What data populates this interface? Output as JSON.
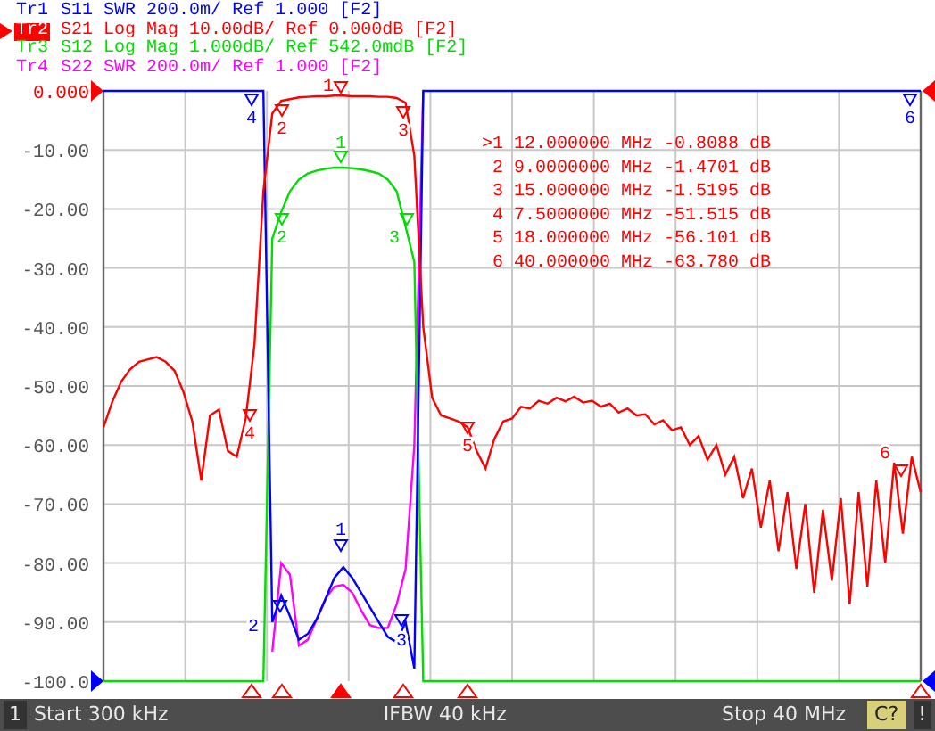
{
  "traces": [
    {
      "name": "Tr1",
      "parameter": "S11",
      "format": "SWR",
      "scale": "200.0m/",
      "reference": "Ref 1.000",
      "flag": "[F2]",
      "color": "#0000ff",
      "selected": false,
      "markers": [
        "4",
        "1",
        "2",
        "3",
        "6"
      ]
    },
    {
      "name": "Tr2",
      "parameter": "S21",
      "format": "Log Mag",
      "scale": "10.00dB/",
      "reference": "Ref 0.000dB",
      "flag": "[F2]",
      "color": "#ff0000",
      "selected": true,
      "markers": [
        "1",
        "2",
        "3",
        "4",
        "5",
        "6"
      ]
    },
    {
      "name": "Tr3",
      "parameter": "S12",
      "format": "Log Mag",
      "scale": "1.000dB/",
      "reference": "Ref 542.0mdB",
      "flag": "[F2]",
      "color": "#00dd00",
      "selected": false,
      "markers": [
        "1",
        "2",
        "3"
      ]
    },
    {
      "name": "Tr4",
      "parameter": "S22",
      "format": "SWR",
      "scale": "200.0m/",
      "reference": "Ref 1.000",
      "flag": "[F2]",
      "color": "#ff00ff",
      "selected": false
    }
  ],
  "chart_data": {
    "type": "line",
    "grid": true,
    "ylim": [
      -100,
      0
    ],
    "yticks": [
      {
        "value": 0,
        "label": "0.000"
      },
      {
        "value": -10,
        "label": "-10.00"
      },
      {
        "value": -20,
        "label": "-20.00"
      },
      {
        "value": -30,
        "label": "-30.00"
      },
      {
        "value": -40,
        "label": "-40.00"
      },
      {
        "value": -50,
        "label": "-50.00"
      },
      {
        "value": -60,
        "label": "-60.00"
      },
      {
        "value": -70,
        "label": "-70.00"
      },
      {
        "value": -80,
        "label": "-80.00"
      },
      {
        "value": -90,
        "label": "-90.00"
      },
      {
        "value": -100,
        "label": "-100.0"
      }
    ],
    "categories": [
      null,
      null,
      null,
      null,
      null,
      null,
      null,
      null,
      null,
      null,
      null,
      null,
      null,
      null,
      null,
      null,
      null,
      null,
      null,
      null,
      null,
      null,
      null,
      null,
      null,
      null,
      null,
      null,
      null,
      null,
      null,
      null,
      null,
      null,
      null,
      null,
      null,
      null,
      null,
      null,
      null,
      null,
      null,
      null,
      null,
      null,
      null,
      null,
      null,
      null,
      null,
      null,
      null,
      null,
      null,
      null,
      null,
      null,
      null,
      null,
      null,
      null,
      null,
      null,
      null,
      null,
      null,
      null,
      null,
      null,
      null,
      null,
      null,
      null,
      null,
      null,
      null,
      null,
      null,
      null,
      null,
      null,
      null,
      null,
      null,
      null,
      null,
      null,
      null,
      null,
      null,
      null,
      null
    ],
    "series": [
      {
        "color": "#ff00ff",
        "values": [
          null,
          null,
          null,
          null,
          null,
          null,
          null,
          null,
          null,
          null,
          null,
          null,
          null,
          null,
          null,
          null,
          null,
          null,
          null,
          -95,
          -80,
          -82,
          -94,
          -93,
          -89.5,
          -86,
          -84,
          -83.7,
          -85,
          -88,
          -90.5,
          -91,
          -91,
          -87,
          -81,
          -60,
          0,
          null,
          null,
          null,
          null,
          null,
          null,
          null,
          null,
          null,
          null,
          null,
          null,
          null,
          null,
          null,
          null,
          null,
          null,
          null,
          null,
          null,
          null,
          null,
          null,
          null,
          null,
          null,
          null,
          null,
          null,
          null,
          null,
          null,
          null,
          null,
          null,
          null,
          null,
          null,
          null,
          null,
          null,
          null,
          null,
          null,
          null,
          null,
          null,
          null,
          null,
          null,
          null,
          null,
          null,
          null,
          null
        ]
      },
      {
        "color": "#00dd00",
        "values": [
          -100,
          -100,
          -100,
          -100,
          -100,
          -100,
          -100,
          -100,
          -100,
          -100,
          -100,
          -100,
          -100,
          -100,
          -100,
          -100,
          -100,
          -100,
          -100,
          -25,
          -20.5,
          -17,
          -15,
          -14,
          -13.5,
          -13.2,
          -13,
          -13,
          -13.1,
          -13.3,
          -13.6,
          -14,
          -15,
          -17,
          -23,
          -29,
          -100,
          -100,
          -100,
          -100,
          -100,
          -100,
          -100,
          -100,
          -100,
          -100,
          -100,
          -100,
          -100,
          -100,
          -100,
          -100,
          -100,
          -100,
          -100,
          -100,
          -100,
          -100,
          -100,
          -100,
          -100,
          -100,
          -100,
          -100,
          -100,
          -100,
          -100,
          -100,
          -100,
          -100,
          -100,
          -100,
          -100,
          -100,
          -100,
          -100,
          -100,
          -100,
          -100,
          -100,
          -100,
          -100,
          -100,
          -100,
          -100,
          -100,
          -100,
          -100,
          -100,
          -100,
          -100,
          -100,
          -100
        ]
      },
      {
        "color": "#0000ff",
        "values": [
          0,
          0,
          0,
          0,
          0,
          0,
          0,
          0,
          0,
          0,
          0,
          0,
          0,
          0,
          0,
          0,
          0,
          0,
          0,
          -90,
          -85.5,
          -89,
          -93,
          -92,
          -89.5,
          -86,
          -82.5,
          -80.7,
          -82.5,
          -85,
          -87.5,
          -90,
          -92.5,
          -93.4,
          -90,
          -97.9,
          0,
          0,
          0,
          0,
          0,
          0,
          0,
          0,
          0,
          0,
          0,
          0,
          0,
          0,
          0,
          0,
          0,
          0,
          0,
          0,
          0,
          0,
          0,
          0,
          0,
          0,
          0,
          0,
          0,
          0,
          0,
          0,
          0,
          0,
          0,
          0,
          0,
          0,
          0,
          0,
          0,
          0,
          0,
          0,
          0,
          0,
          0,
          0,
          0,
          0,
          0,
          0,
          0,
          0,
          0,
          0,
          0
        ]
      },
      {
        "color": "#ff0000",
        "values": [
          -57,
          -52.6,
          -49.2,
          -47.2,
          -45.9,
          -45.5,
          -45.1,
          -45.9,
          -47.4,
          -51,
          -56,
          -66,
          -55,
          -54,
          -61,
          -62,
          -55.5,
          -43,
          -17,
          -3.8,
          -1.7,
          -1.4,
          -1.1,
          -1,
          -0.9,
          -0.9,
          -0.8,
          -0.8,
          -0.9,
          -0.9,
          -0.9,
          -1,
          -1,
          -1.2,
          -2,
          -11,
          -40,
          -52,
          -55,
          -55.5,
          -56,
          -57,
          -61,
          -64,
          -59,
          -56,
          -55.5,
          -53.5,
          -53.8,
          -52.5,
          -53,
          -52,
          -52.6,
          -51.8,
          -52.8,
          -52.5,
          -53.5,
          -53,
          -54.5,
          -53.8,
          -55,
          -54.8,
          -56.5,
          -55.8,
          -57.5,
          -57,
          -60,
          -58.5,
          -62.5,
          -60,
          -65,
          -62,
          -69,
          -64,
          -74,
          -66,
          -78,
          -68,
          -81,
          -70,
          -85,
          -71,
          -83,
          -69,
          -87,
          -68,
          -84,
          -66,
          -80,
          -63,
          -75,
          -62,
          -68
        ]
      }
    ]
  },
  "marker_table": [
    {
      "label": ">1",
      "frequency": "12.000000 MHz",
      "value": "-0.8088 dB",
      "active": true
    },
    {
      "label": "2",
      "frequency": "9.0000000 MHz",
      "value": "-1.4701 dB",
      "active": false
    },
    {
      "label": "3",
      "frequency": "15.000000 MHz",
      "value": "-1.5195 dB",
      "active": false
    },
    {
      "label": "4",
      "frequency": "7.5000000 MHz",
      "value": "-51.515 dB",
      "active": false
    },
    {
      "label": "5",
      "frequency": "18.000000 MHz",
      "value": "-56.101 dB",
      "active": false
    },
    {
      "label": "6",
      "frequency": "40.000000 MHz",
      "value": "-63.780 dB",
      "active": false
    }
  ],
  "status_bar": {
    "channel": "1",
    "start": "Start 300 kHz",
    "ifbw": "IFBW 40 kHz",
    "stop": "Stop 40 MHz",
    "calibration": "C?",
    "alert": "!"
  }
}
